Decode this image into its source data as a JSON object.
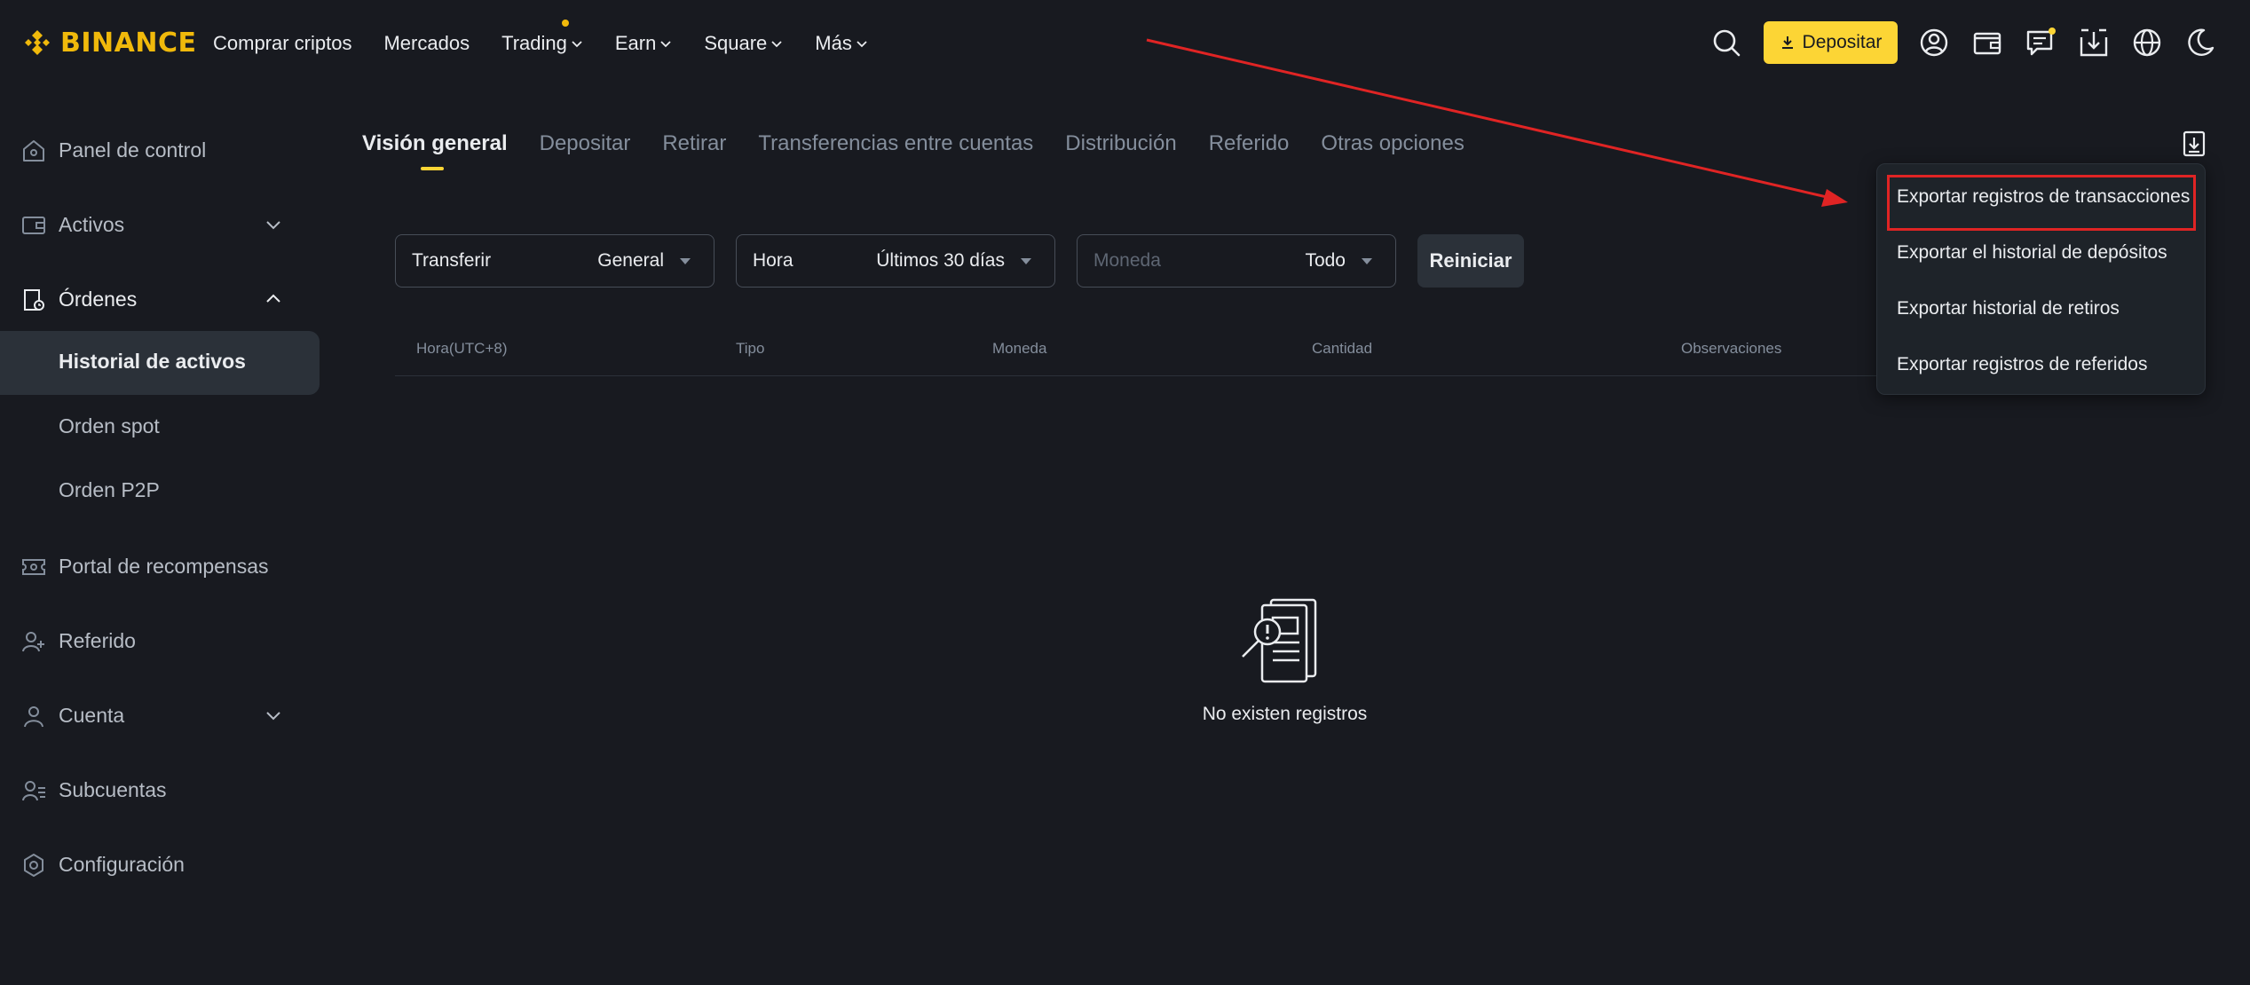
{
  "header": {
    "logo_text": "BINANCE",
    "nav": [
      {
        "label": "Comprar criptos",
        "has_chevron": false,
        "has_dot": false
      },
      {
        "label": "Mercados",
        "has_chevron": false,
        "has_dot": false
      },
      {
        "label": "Trading",
        "has_chevron": true,
        "has_dot": true
      },
      {
        "label": "Earn",
        "has_chevron": true,
        "has_dot": false
      },
      {
        "label": "Square",
        "has_chevron": true,
        "has_dot": false
      },
      {
        "label": "Más",
        "has_chevron": true,
        "has_dot": false
      }
    ],
    "deposit_label": "Depositar",
    "icons": [
      "search-icon",
      "user-icon",
      "wallet-icon",
      "messages-icon",
      "download-app-icon",
      "globe-icon",
      "moon-icon"
    ],
    "accent_color": "#fcd535"
  },
  "sidebar": {
    "items": [
      {
        "label": "Panel de control",
        "icon": "dashboard-icon"
      },
      {
        "label": "Activos",
        "icon": "wallet-icon",
        "expand": "down"
      },
      {
        "label": "Órdenes",
        "icon": "orders-icon",
        "expand": "up"
      },
      {
        "label": "Portal de recompensas",
        "icon": "ticket-icon"
      },
      {
        "label": "Referido",
        "icon": "add-user-icon"
      },
      {
        "label": "Cuenta",
        "icon": "user-icon",
        "expand": "down"
      },
      {
        "label": "Subcuentas",
        "icon": "subaccounts-icon"
      },
      {
        "label": "Configuración",
        "icon": "settings-icon"
      }
    ],
    "sub_items": [
      {
        "label": "Historial de activos",
        "active": true
      },
      {
        "label": "Orden spot",
        "active": false
      },
      {
        "label": "Orden P2P",
        "active": false
      }
    ]
  },
  "tabs": [
    "Visión general",
    "Depositar",
    "Retirar",
    "Transferencias entre cuentas",
    "Distribución",
    "Referido",
    "Otras opciones"
  ],
  "active_tab": "Visión general",
  "filters": [
    {
      "label": "Transferir",
      "value": "General"
    },
    {
      "label": "Hora",
      "value": "Últimos 30 días"
    },
    {
      "placeholder": "Moneda",
      "value": "Todo"
    }
  ],
  "reset_label": "Reiniciar",
  "table": {
    "columns": [
      "Hora(UTC+8)",
      "Tipo",
      "Moneda",
      "Cantidad",
      "Observaciones"
    ],
    "empty_text": "No existen registros"
  },
  "export_menu": {
    "items": [
      "Exportar registros de transacciones",
      "Exportar el historial de depósitos",
      "Exportar historial de retiros",
      "Exportar registros de referidos"
    ],
    "highlighted": "Exportar registros de transacciones"
  },
  "annotation_color": "#e02424"
}
